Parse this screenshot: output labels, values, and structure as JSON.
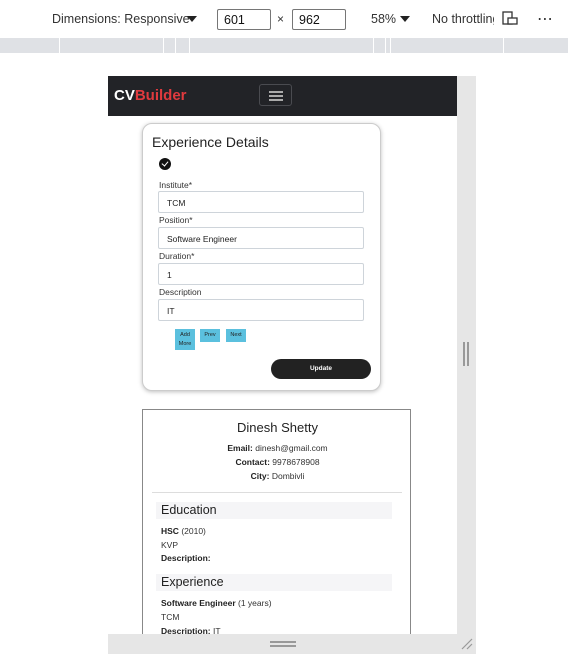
{
  "devtools": {
    "dimensions_label": "Dimensions: Responsive",
    "width": "601",
    "times": "×",
    "height": "962",
    "zoom": "58%",
    "throttle": "No throttling",
    "more": "⋯"
  },
  "app": {
    "brand_cv": "CV",
    "brand_builder": "Builder"
  },
  "form": {
    "title": "Experience Details",
    "fields": [
      {
        "label": "Institute*",
        "value": "TCM"
      },
      {
        "label": "Position*",
        "value": "Software Engineer"
      },
      {
        "label": "Duration*",
        "value": "1"
      },
      {
        "label": "Description",
        "value": "IT"
      }
    ],
    "add_more_line1": "Add",
    "add_more_line2": "More",
    "prev": "Prev",
    "next": "Next",
    "update": "Update"
  },
  "preview": {
    "name": "Dinesh Shetty",
    "email_label": "Email:",
    "email": " dinesh@gmail.com",
    "contact_label": "Contact:",
    "contact": " 9978678908",
    "city_label": "City:",
    "city": " Dombivli",
    "education_heading": "Education",
    "edu_degree": "HSC",
    "edu_year": " (2010)",
    "edu_institute": "KVP",
    "edu_desc_label": "Description:",
    "experience_heading": "Experience",
    "exp_position": "Software Engineer",
    "exp_duration": " (1 years)",
    "exp_institute": "TCM",
    "exp_desc_label": "Description:",
    "exp_desc": " IT"
  }
}
